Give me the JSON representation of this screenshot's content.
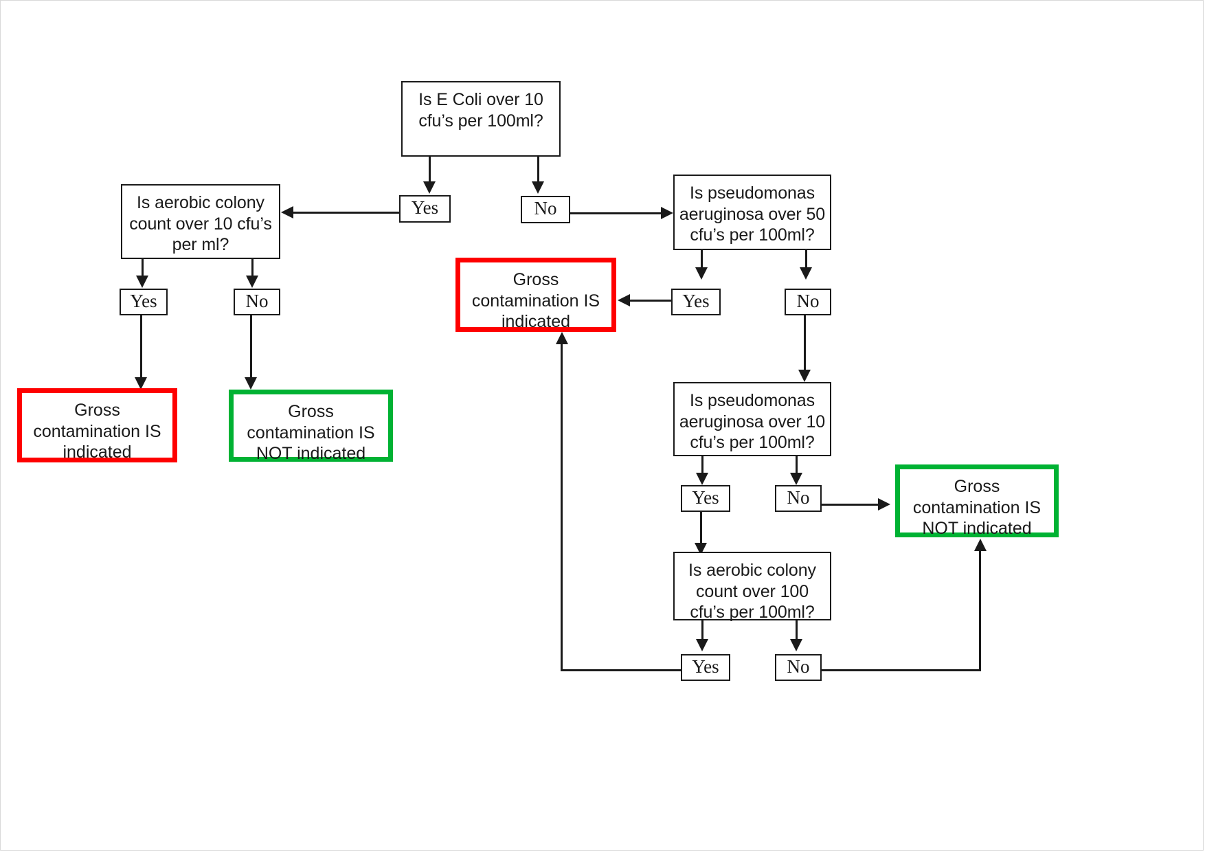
{
  "diagram": {
    "title": "Water sample contamination decision flowchart",
    "colors": {
      "red": "#fe0000",
      "green": "#00b233",
      "line": "#1a1a1a",
      "background": "#ffffff"
    },
    "nodes": {
      "q_ecoli": {
        "text": "Is E Coli over 10 cfu’s per 100ml?",
        "type": "decision"
      },
      "q_aerobic_10": {
        "text": "Is aerobic colony count over 10 cfu’s per ml?",
        "type": "decision"
      },
      "q_pseudo_50": {
        "text": "Is pseudomonas aeruginosa over 50 cfu’s per 100ml?",
        "type": "decision"
      },
      "q_pseudo_10": {
        "text": "Is pseudomonas aeruginosa over 10 cfu’s per 100ml?",
        "type": "decision"
      },
      "q_aerobic_100": {
        "text": "Is aerobic colony count over 100 cfu’s per 100ml?",
        "type": "decision"
      },
      "out_gross_left": {
        "text": "Gross contamination IS indicated",
        "type": "outcome",
        "status": "red"
      },
      "out_notgross_left": {
        "text": "Gross contamination IS NOT indicated",
        "type": "outcome",
        "status": "green"
      },
      "out_gross_mid": {
        "text": "Gross contamination IS indicated",
        "type": "outcome",
        "status": "red"
      },
      "out_notgross_right": {
        "text": "Gross contamination IS NOT indicated",
        "type": "outcome",
        "status": "green"
      }
    },
    "labels": {
      "ecoli_yes": "Yes",
      "ecoli_no": "No",
      "aerobic10_yes": "Yes",
      "aerobic10_no": "No",
      "pseudo50_yes": "Yes",
      "pseudo50_no": "No",
      "pseudo10_yes": "Yes",
      "pseudo10_no": "No",
      "aerobic100_yes": "Yes",
      "aerobic100_no": "No"
    }
  }
}
